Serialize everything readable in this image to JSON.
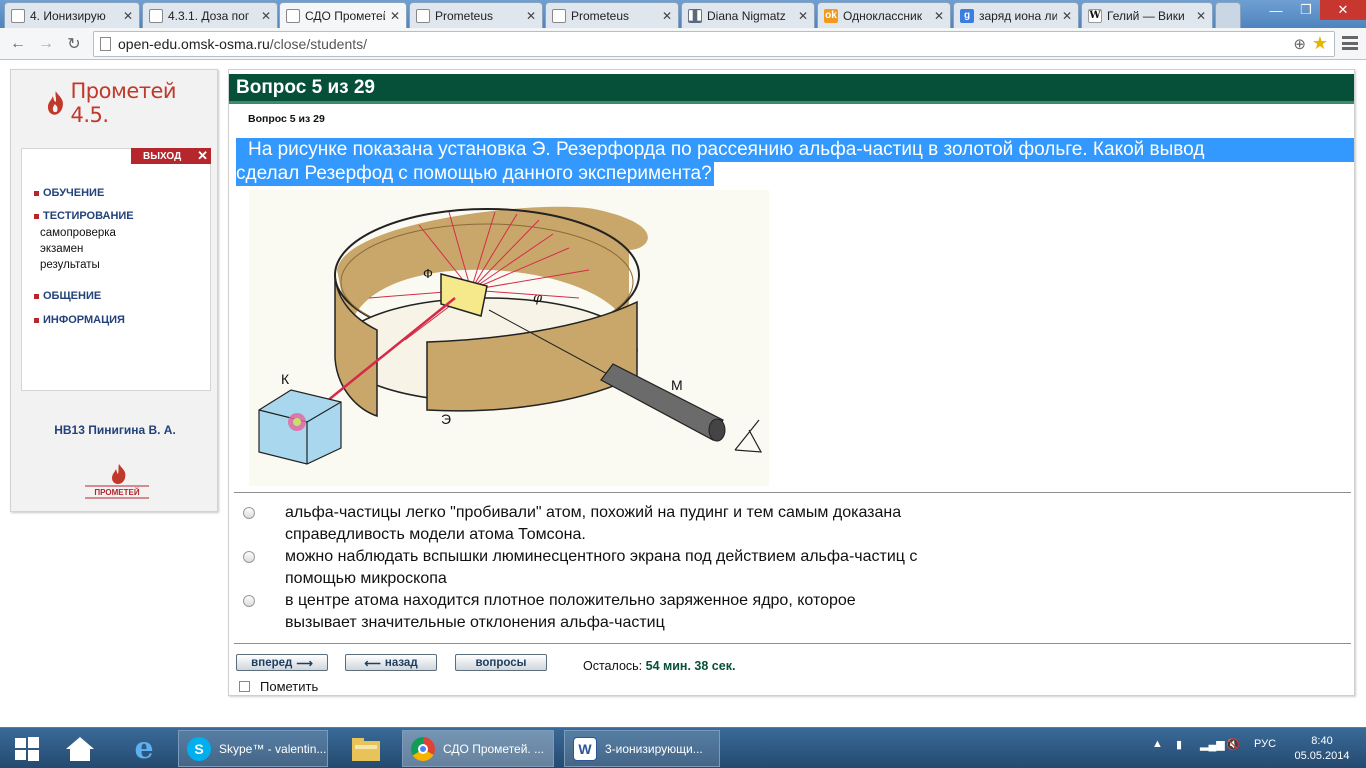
{
  "browser": {
    "tabs": [
      {
        "label": "4. Ионизирую",
        "icon": "document-icon",
        "active": false
      },
      {
        "label": "4.3.1. Доза пог",
        "icon": "document-icon",
        "active": false
      },
      {
        "label": "СДО Прометей",
        "icon": "document-icon",
        "active": true
      },
      {
        "label": "Prometeus",
        "icon": "document-icon",
        "active": false
      },
      {
        "label": "Prometeus",
        "icon": "document-icon",
        "active": false
      },
      {
        "label": "Diana Nigmatz",
        "icon": "pause-icon",
        "active": false
      },
      {
        "label": "Одноклассник",
        "icon": "odnoklassniki-icon",
        "active": false
      },
      {
        "label": "заряд иона ли",
        "icon": "google-icon",
        "active": false
      },
      {
        "label": "Гелий — Вики",
        "icon": "wikipedia-icon",
        "active": false
      }
    ],
    "url_host": "open-edu.omsk-osma.ru",
    "url_path": "/close/students/"
  },
  "sidebar": {
    "logo_text": "Прометей 4.5.",
    "exit_label": "ВЫХОД",
    "menu": [
      {
        "label": "ОБУЧЕНИЕ"
      },
      {
        "label": "ТЕСТИРОВАНИЕ"
      },
      {
        "label": "ОБЩЕНИЕ"
      },
      {
        "label": "ИНФОРМАЦИЯ"
      }
    ],
    "submenu": [
      "самопроверка",
      "экзамен",
      "результаты"
    ],
    "user": "НВ13 Пинигина В. А.",
    "footer_logo_text": "ПРОМЕТЕЙ"
  },
  "question": {
    "header": "Вопрос 5 из 29",
    "sub": "Вопрос 5 из 29",
    "text_line1": "На рисунке показана установка Э. Резерфорда по рассеянию альфа-частиц в золотой фольге. Какой вывод",
    "text_line2": "сделал Резерфод с помощью данного эксперимента?",
    "figure_labels": {
      "source": "К",
      "foil": "Ф",
      "angle": "φ",
      "screen": "Э",
      "microscope": "М"
    },
    "answers": [
      {
        "line1": "альфа-частицы легко \"пробивали\" атом, похожий на пудинг и тем самым доказана",
        "line2": "справедливость модели атома Томсона."
      },
      {
        "line1": "можно наблюдать вспышки люминесцентного экрана под действием альфа-частиц с",
        "line2": "помощью микроскопа"
      },
      {
        "line1": "в центре атома находится плотное положительно заряженное ядро, которое",
        "line2": "вызывает значительные отклонения альфа-частиц"
      }
    ],
    "buttons": {
      "forward": "вперед",
      "back": "назад",
      "questions": "вопросы"
    },
    "remaining_label": "Осталось:",
    "remaining_time": "54 мин. 38 сек.",
    "mark_label": "Пометить"
  },
  "taskbar": {
    "apps": [
      {
        "label": "Skype™ - valentin...",
        "icon": "skype-icon"
      },
      {
        "label": "СДО Прометей. ...",
        "icon": "chrome-icon"
      },
      {
        "label": "3-ионизирующи...",
        "icon": "word-icon"
      }
    ],
    "lang": "РУС",
    "time": "8:40",
    "date": "05.05.2014"
  },
  "colors": {
    "header_green": "#06503a",
    "selection_blue": "#3399ff",
    "brand_red": "#b5262d",
    "link_blue": "#23427a"
  }
}
